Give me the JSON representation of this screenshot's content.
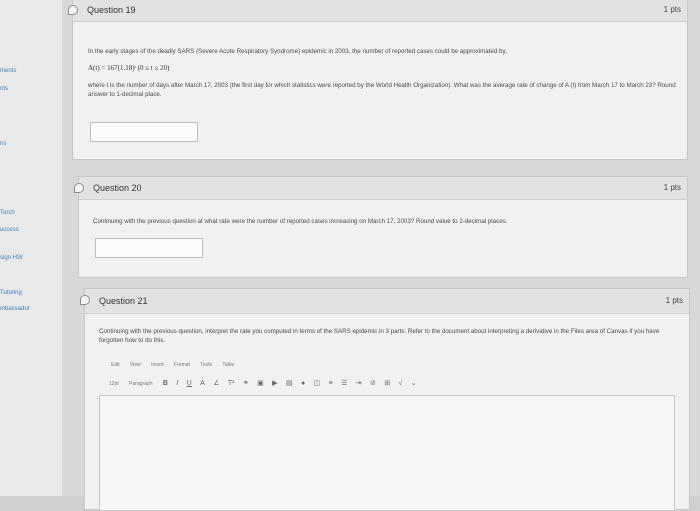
{
  "sidebar": {
    "items": [
      "ments",
      "nts",
      "ns",
      "Torch",
      "uccess",
      "sign HW",
      "Tutoring",
      "mbassador"
    ]
  },
  "questions": [
    {
      "title": "Question 19",
      "points": "1 pts",
      "intro": "In the early stages of the deadly SARS (Severe Acute Respiratory Syndrome) epidemic in 2003, the number of reported cases could be approximated by,",
      "formula": "A(t) = 167(1.18)ᵗ  (0 ≤ t ≤ 20)",
      "body": "where t is the number of days after March 17, 2003 (the first day for which statistics were reported by the World Health Organization). What was the average rate of change of A (t) from March 17 to March 23? Round answer to 1-decimal place."
    },
    {
      "title": "Question 20",
      "points": "1 pts",
      "body": "Continuing with the previous question at what rate were the number of reported cases increasing on March 17, 2003? Round value to 2-decimal places."
    },
    {
      "title": "Question 21",
      "points": "1 pts",
      "body": "Continuing with the previous question, interpret the rate you computed in terms of the SARS epidemic in 3 parts. Refer to the document about interpreting a derivative in the Files area of Canvas if you have forgotten how to do this."
    }
  ],
  "editor": {
    "menus": [
      "Edit",
      "View",
      "Insert",
      "Format",
      "Tools",
      "Table"
    ],
    "font_size": "12pt",
    "block_format": "Paragraph",
    "format_buttons": [
      "B",
      "I",
      "U",
      "A",
      "∠",
      "T²"
    ]
  }
}
